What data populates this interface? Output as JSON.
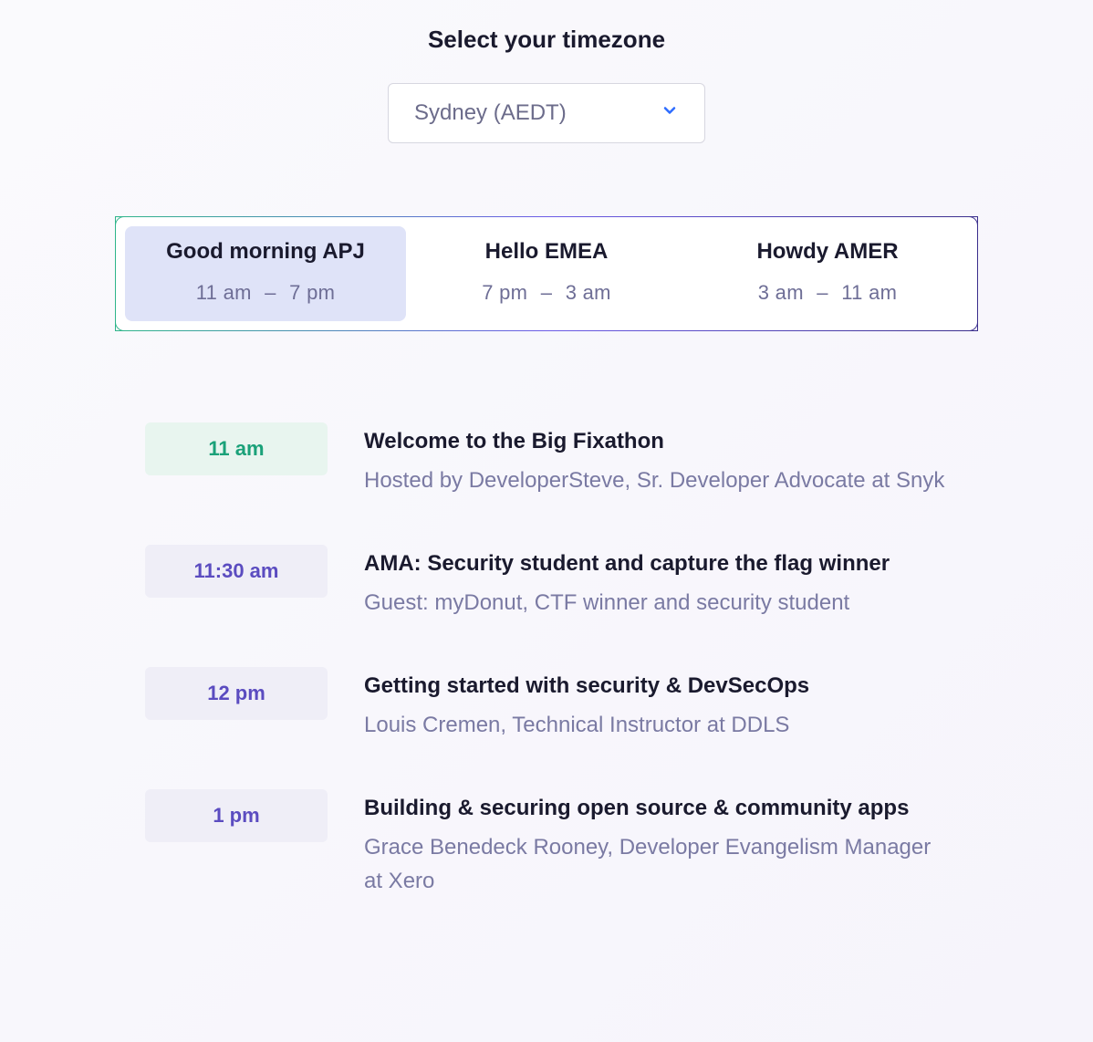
{
  "header": {
    "title": "Select your timezone"
  },
  "timezone": {
    "selected": "Sydney (AEDT)"
  },
  "tabs": [
    {
      "title": "Good morning APJ",
      "start": "11 am",
      "end": "7 pm",
      "active": true
    },
    {
      "title": "Hello EMEA",
      "start": "7 pm",
      "end": "3 am",
      "active": false
    },
    {
      "title": "Howdy AMER",
      "start": "3 am",
      "end": "11 am",
      "active": false
    }
  ],
  "schedule": [
    {
      "time": "11 am",
      "pill": "green",
      "title": "Welcome to the Big Fixathon",
      "sub": "Hosted by DeveloperSteve, Sr. Developer Advocate at Snyk"
    },
    {
      "time": "11:30 am",
      "pill": "purple",
      "title": "AMA: Security student and capture the flag winner",
      "sub": "Guest: myDonut, CTF winner and security student"
    },
    {
      "time": "12 pm",
      "pill": "purple",
      "title": "Getting started with security & DevSecOps",
      "sub": "Louis Cremen, Technical Instructor at DDLS"
    },
    {
      "time": "1 pm",
      "pill": "purple",
      "title": "Building & securing open source & community apps",
      "sub": "Grace Benedeck Rooney, Developer Evangelism Manager at Xero"
    }
  ]
}
